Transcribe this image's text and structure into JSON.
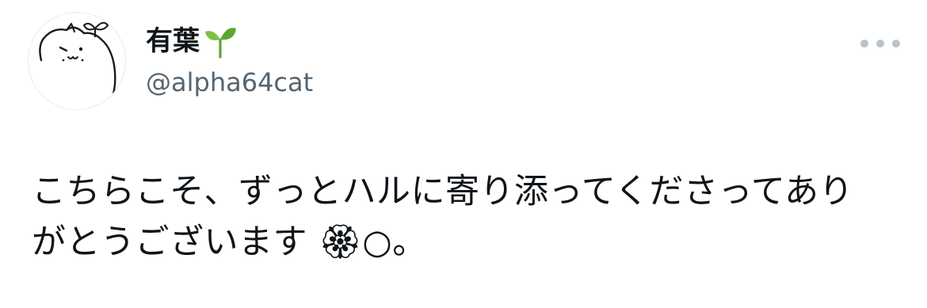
{
  "author": {
    "display_name": "有葉",
    "handle": "@alpha64cat",
    "avatar_icon": "cat-with-sprout-avatar-icon",
    "name_emoji_icon": "sprout-icon"
  },
  "more_menu_icon": "more-horizontal-icon",
  "tweet": {
    "lines": [
      "こちらこそ、ずっとハルに寄り添ってくださってあり",
      "がとうございます 🏵○。"
    ]
  },
  "colors": {
    "text_primary": "#0f1419",
    "text_secondary": "#536471",
    "icon_gray": "#b9c3cc",
    "sprout_green": "#5aa832"
  }
}
